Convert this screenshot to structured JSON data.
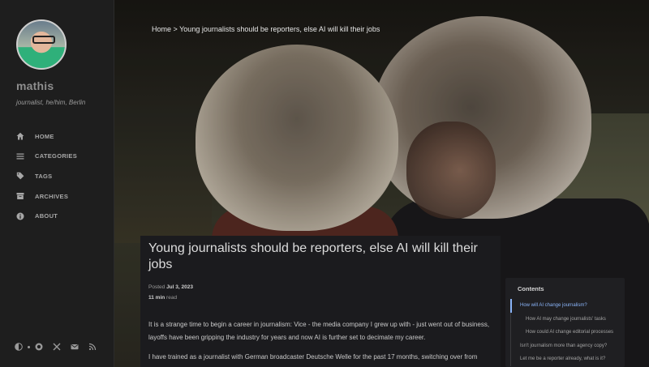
{
  "sidebar": {
    "name": "mathis",
    "subtitle": "journalist, he/him, Berlin",
    "nav": [
      {
        "label": "HOME",
        "icon": "home-icon"
      },
      {
        "label": "CATEGORIES",
        "icon": "list-icon"
      },
      {
        "label": "TAGS",
        "icon": "tag-icon"
      },
      {
        "label": "ARCHIVES",
        "icon": "archive-icon"
      },
      {
        "label": "ABOUT",
        "icon": "info-icon"
      }
    ],
    "footer_icons": [
      "theme-toggle-icon",
      "github-icon",
      "x-icon",
      "email-icon",
      "rss-icon"
    ]
  },
  "breadcrumb": {
    "home": "Home",
    "separator": " > ",
    "current": "Young journalists should be reporters, else AI will kill their jobs"
  },
  "post": {
    "title": "Young journalists should be reporters, else AI will kill their jobs",
    "posted_label": "Posted",
    "date": "Jul 3, 2023",
    "read_time": "11 min",
    "read_suffix": "read",
    "paragraphs": [
      "It is a strange time to begin a career in journalism: Vice - the media company I grew up with - just went out of business, layoffs have been gripping the industry for years and now AI is further set to decimate my career.",
      "I have trained as a journalist with German broadcaster Deutsche Welle for the past 17 months, switching over from"
    ]
  },
  "toc": {
    "title": "Contents",
    "items": [
      {
        "text": "How will AI change journalism?",
        "level": 1,
        "active": true
      },
      {
        "text": "How AI may change journalists' tasks",
        "level": 2,
        "active": false
      },
      {
        "text": "How could AI change editorial processes",
        "level": 2,
        "active": false
      },
      {
        "text": "Isn't journalism more than agency copy?",
        "level": 1,
        "active": false
      },
      {
        "text": "Let me be a reporter already, what is it?",
        "level": 1,
        "active": false
      }
    ]
  },
  "colors": {
    "accent": "#8ab4f8",
    "sidebar_bg": "#1e1e1e",
    "content_bg": "#1b1b1e"
  }
}
